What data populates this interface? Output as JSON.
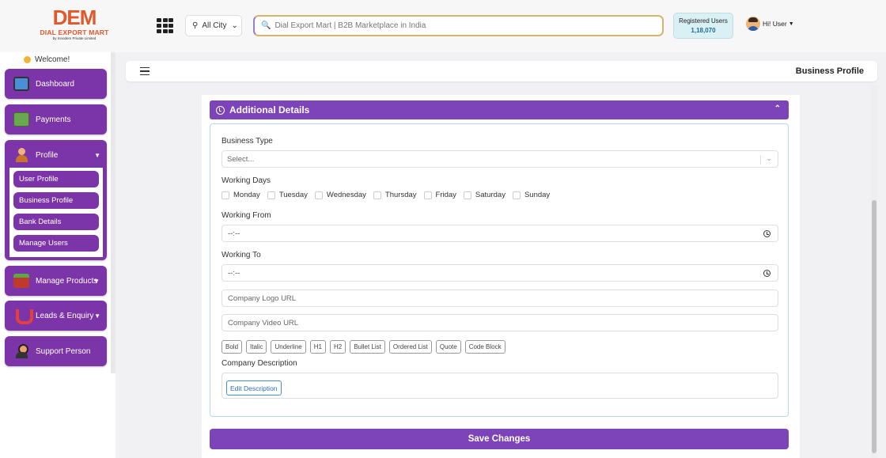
{
  "header": {
    "logo_mark": "DEM",
    "logo_name": "DIAL EXPORT MART",
    "logo_sub": "by Innodem Private Limited",
    "city": "All City",
    "search_placeholder": "Dial Export Mart | B2B Marketplace in India",
    "registered_users_label": "Registered Users",
    "registered_users_count": "1,18,070",
    "user_greeting": "Hi! User"
  },
  "sidebar": {
    "welcome": "Welcome!",
    "items": [
      {
        "label": "Dashboard",
        "icon": "monitor-icon"
      },
      {
        "label": "Payments",
        "icon": "payment-icon"
      },
      {
        "label": "Profile",
        "icon": "person-icon"
      },
      {
        "label": "Manage Products",
        "icon": "box-icon"
      },
      {
        "label": "Leads & Enquiry",
        "icon": "magnet-icon"
      },
      {
        "label": "Support Person",
        "icon": "support-icon"
      }
    ],
    "profile_sub": [
      "User Profile",
      "Business Profile",
      "Bank Details",
      "Manage Users"
    ]
  },
  "topbar": {
    "title": "Business Profile"
  },
  "section": {
    "title": "Additional Details",
    "business_type_label": "Business Type",
    "business_type_value": "Select...",
    "working_days_label": "Working Days",
    "days": [
      "Monday",
      "Tuesday",
      "Wednesday",
      "Thursday",
      "Friday",
      "Saturday",
      "Sunday"
    ],
    "working_from_label": "Working From",
    "working_from_value": "--:--",
    "working_to_label": "Working To",
    "working_to_value": "--:--",
    "logo_url_placeholder": "Company Logo URL",
    "video_url_placeholder": "Company Video URL",
    "toolbar": [
      "Bold",
      "Italic",
      "Underline",
      "H1",
      "H2",
      "Bullet List",
      "Ordered List",
      "Quote",
      "Code Block"
    ],
    "description_label": "Company Description",
    "edit_description": "Edit Description",
    "save": "Save Changes"
  },
  "colors": {
    "brand_purple": "#7c35a8",
    "accent_purple": "#7c44b8",
    "logo_orange": "#e2572b"
  }
}
